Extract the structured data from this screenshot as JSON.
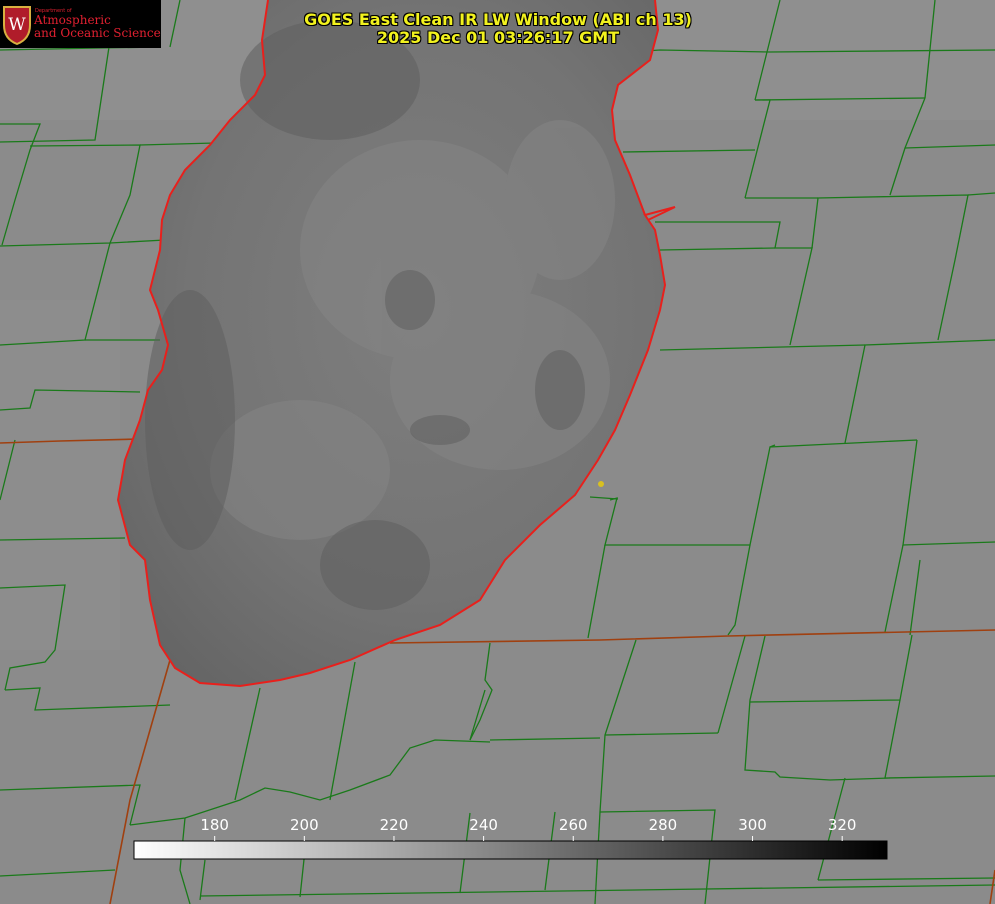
{
  "logo": {
    "department": "Department of",
    "line1": "Atmospheric",
    "line2": "and Oceanic Sciences",
    "crest_letter": "W"
  },
  "title": {
    "line1": "GOES East Clean IR LW Window (ABI ch 13)",
    "line2": "2025 Dec 01 03:26:17 GMT"
  },
  "colors": {
    "land": "#8a8a8a",
    "lake": "#707070",
    "county_lines": "#1a7a1a",
    "state_lines": "#a04010",
    "coastline": "#e8201c",
    "title_text": "#f2f21e",
    "marker": "#d8c020"
  },
  "colorbar": {
    "ticks": [
      180,
      200,
      220,
      240,
      260,
      280,
      300,
      320
    ],
    "range": [
      162,
      330
    ],
    "gradient": "white-to-black"
  }
}
